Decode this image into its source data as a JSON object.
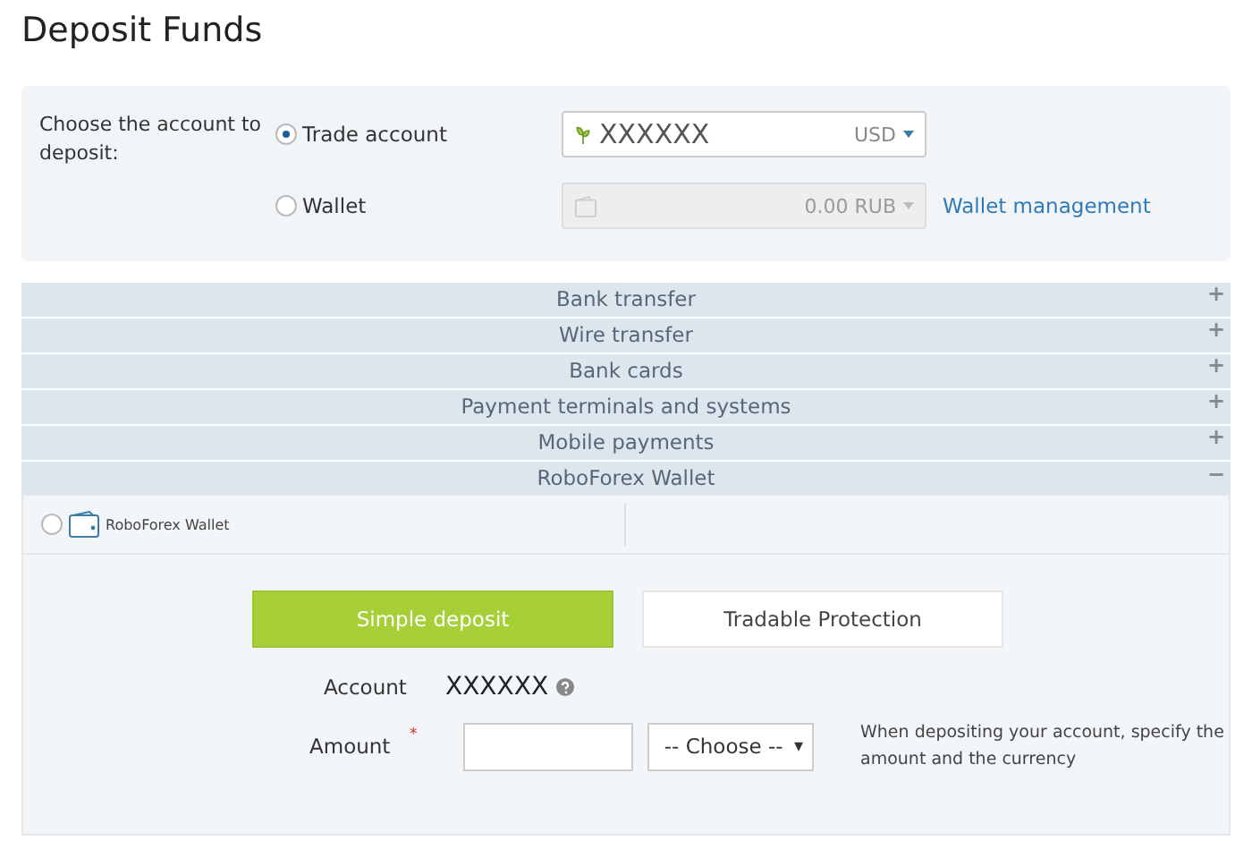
{
  "title": "Deposit Funds",
  "account_choice": {
    "label": "Choose the account to deposit:",
    "options": [
      {
        "label": "Trade account",
        "selected": true,
        "field": {
          "value": "XXXXXX",
          "currency": "USD",
          "disabled": false
        }
      },
      {
        "label": "Wallet",
        "selected": false,
        "field": {
          "value": "0.00 RUB",
          "disabled": true
        },
        "link": "Wallet management"
      }
    ]
  },
  "sections": [
    {
      "label": "Bank transfer",
      "expanded": false,
      "toggle": "+"
    },
    {
      "label": "Wire transfer",
      "expanded": false,
      "toggle": "+"
    },
    {
      "label": "Bank cards",
      "expanded": false,
      "toggle": "+"
    },
    {
      "label": "Payment terminals and systems",
      "expanded": false,
      "toggle": "+"
    },
    {
      "label": "Mobile payments",
      "expanded": false,
      "toggle": "+"
    },
    {
      "label": "RoboForex Wallet",
      "expanded": true,
      "toggle": "−"
    }
  ],
  "method": {
    "label": "RoboForex Wallet",
    "selected": false
  },
  "deposit_tabs": [
    {
      "label": "Simple deposit",
      "selected": true
    },
    {
      "label": "Tradable Protection",
      "selected": false
    }
  ],
  "account_row": {
    "label": "Account",
    "value": "XXXXXX"
  },
  "amount_row": {
    "label": "Amount",
    "required_mark": "*",
    "select": "-- Choose --",
    "caret": "▾",
    "hint": "When depositing your account, specify the amount and the currency"
  }
}
